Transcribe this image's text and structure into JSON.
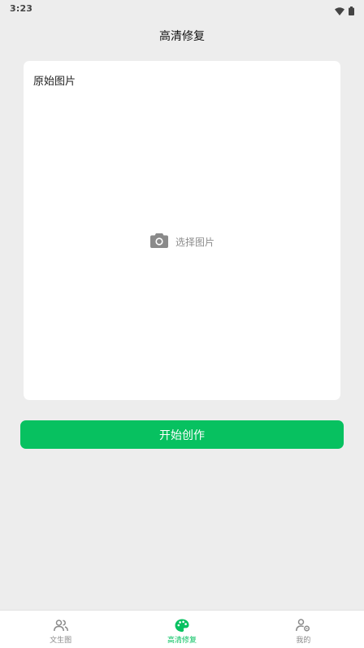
{
  "status_bar": {
    "time": "3:23"
  },
  "header": {
    "title": "高清修复"
  },
  "card": {
    "label": "原始图片",
    "picker_label": "选择图片"
  },
  "actions": {
    "start_label": "开始创作"
  },
  "tabbar": {
    "tabs": [
      {
        "label": "文生图",
        "icon": "users-icon",
        "active": false
      },
      {
        "label": "高清修复",
        "icon": "palette-icon",
        "active": true
      },
      {
        "label": "我的",
        "icon": "user-settings-icon",
        "active": false
      }
    ]
  },
  "colors": {
    "accent": "#07c160",
    "background": "#ededed",
    "card": "#ffffff",
    "muted": "#8c8c8c"
  }
}
